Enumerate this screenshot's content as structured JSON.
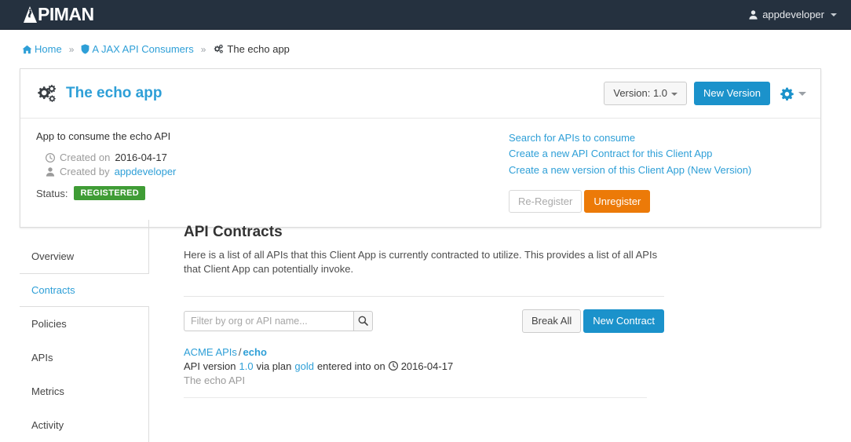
{
  "navbar": {
    "brand": "PIMAN",
    "brand_full": "APIMAN",
    "user": "appdeveloper",
    "user_icon": "user-icon",
    "caret_icon": "chevron-down-icon"
  },
  "breadcrumb": {
    "home": "Home",
    "home_icon": "home-icon",
    "org": "A JAX API Consumers",
    "org_icon": "shield-icon",
    "current": "The echo app",
    "current_icon": "gears-icon",
    "separator": "»"
  },
  "card": {
    "title": "The echo app",
    "title_icon": "gears-icon",
    "version_button": "Version: 1.0",
    "new_version_button": "New Version",
    "gear_icon": "gear-icon",
    "gear_caret_icon": "chevron-down-icon",
    "description": "App to consume the echo API",
    "created_on_label": "Created on",
    "created_on_value": "2016-04-17",
    "created_on_icon": "clock-icon",
    "created_by_label": "Created by",
    "created_by_value": "appdeveloper",
    "created_by_icon": "user-icon",
    "status_label": "Status:",
    "status_value": "REGISTERED",
    "links": [
      "Search for APIs to consume",
      "Create a new API Contract for this Client App",
      "Create a new version of this Client App (New Version)"
    ],
    "re_register_button": "Re-Register",
    "unregister_button": "Unregister"
  },
  "sidebar": {
    "items": [
      {
        "label": "Overview",
        "active": false
      },
      {
        "label": "Contracts",
        "active": true
      },
      {
        "label": "Policies",
        "active": false
      },
      {
        "label": "APIs",
        "active": false
      },
      {
        "label": "Metrics",
        "active": false
      },
      {
        "label": "Activity",
        "active": false
      }
    ]
  },
  "main": {
    "heading": "API Contracts",
    "intro": "Here is a list of all APIs that this Client App is currently contracted to utilize. This provides a list of all APIs that Client App can potentially invoke.",
    "filter_placeholder": "Filter by org or API name...",
    "filter_value": "",
    "search_icon": "search-icon",
    "break_all_button": "Break All",
    "new_contract_button": "New Contract",
    "contracts": [
      {
        "org": "ACME APIs",
        "separator": "/",
        "api": "echo",
        "version_prefix": "API version",
        "version": "1.0",
        "plan_prefix": "via plan",
        "plan": "gold",
        "entered_prefix": "entered into on",
        "date_icon": "clock-icon",
        "date": "2016-04-17",
        "description": "The echo API"
      }
    ]
  },
  "colors": {
    "navbar_bg": "#25313f",
    "link_blue": "#2e9fd7",
    "primary_blue": "#1b92cb",
    "warning_orange": "#ec7a08",
    "success_green": "#3f9c35"
  }
}
